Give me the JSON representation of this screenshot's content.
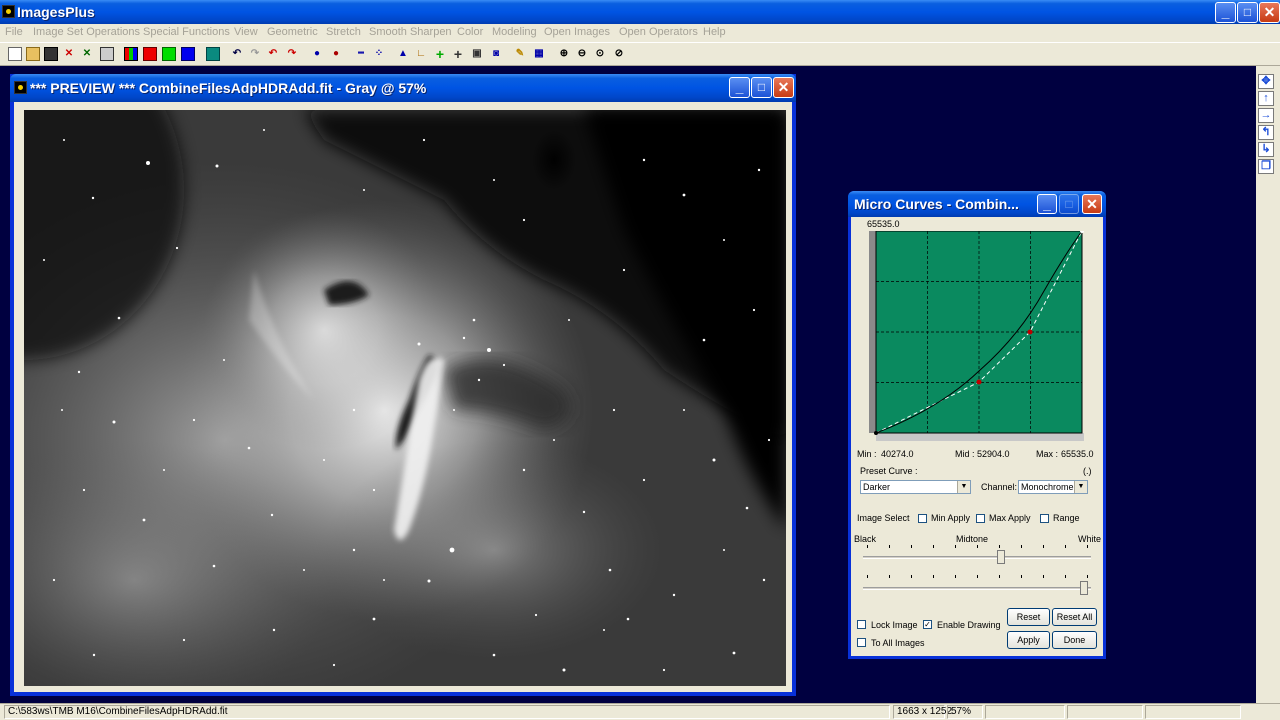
{
  "app": {
    "title": "ImagesPlus",
    "minimize_glyph": "_",
    "maximize_glyph": "□",
    "close_glyph": "✕"
  },
  "menu": {
    "items": [
      {
        "label": "File"
      },
      {
        "label": "Image Set Operations"
      },
      {
        "label": "Special Functions"
      },
      {
        "label": "View"
      },
      {
        "label": "Geometric"
      },
      {
        "label": "Stretch"
      },
      {
        "label": "Smooth Sharpen"
      },
      {
        "label": "Color"
      },
      {
        "label": "Modeling"
      },
      {
        "label": "Open Images"
      },
      {
        "label": "Open Operators"
      },
      {
        "label": "Help"
      }
    ]
  },
  "toolbar": {
    "icons": [
      {
        "name": "new-file-icon",
        "glyph": ""
      },
      {
        "name": "open-folder-icon",
        "glyph": ""
      },
      {
        "name": "save-disk-icon",
        "glyph": ""
      },
      {
        "name": "close-x-icon",
        "glyph": "✕"
      },
      {
        "name": "close-all-icon",
        "glyph": "✕"
      },
      {
        "name": "print-icon",
        "glyph": ""
      },
      {
        "name": "rgb-channels-icon",
        "glyph": ""
      },
      {
        "name": "red-channel-icon",
        "glyph": ""
      },
      {
        "name": "green-channel-icon",
        "glyph": ""
      },
      {
        "name": "blue-channel-icon",
        "glyph": ""
      },
      {
        "name": "grid-icon",
        "glyph": ""
      },
      {
        "name": "undo-icon",
        "glyph": "↶"
      },
      {
        "name": "redo-icon",
        "glyph": "↷"
      },
      {
        "name": "undo-all-icon",
        "glyph": "↶"
      },
      {
        "name": "redo-all-icon",
        "glyph": "↷"
      },
      {
        "name": "circle-select-icon",
        "glyph": "●"
      },
      {
        "name": "point-select-icon",
        "glyph": "●"
      },
      {
        "name": "line-profile-icon",
        "glyph": "┅"
      },
      {
        "name": "dots-icon",
        "glyph": "⁘"
      },
      {
        "name": "histogram-icon",
        "glyph": "▲"
      },
      {
        "name": "axis-icon",
        "glyph": "∟"
      },
      {
        "name": "crosshair-green-icon",
        "glyph": "+"
      },
      {
        "name": "crosshair-icon",
        "glyph": "+"
      },
      {
        "name": "frame-icon",
        "glyph": "▣"
      },
      {
        "name": "picture-icon",
        "glyph": "◙"
      },
      {
        "name": "pencil-icon",
        "glyph": "✎"
      },
      {
        "name": "table-icon",
        "glyph": "▦"
      },
      {
        "name": "zoom-in-icon",
        "glyph": "⊕"
      },
      {
        "name": "zoom-out-icon",
        "glyph": "⊖"
      },
      {
        "name": "zoom-fit-icon",
        "glyph": "⊙"
      },
      {
        "name": "zoom-actual-icon",
        "glyph": "⊘"
      }
    ]
  },
  "side_tools": [
    {
      "name": "move-all-icon",
      "glyph": "✥"
    },
    {
      "name": "arrow-up-icon",
      "glyph": "↑"
    },
    {
      "name": "arrow-right-icon",
      "glyph": "→"
    },
    {
      "name": "rotate-left-icon",
      "glyph": "↰"
    },
    {
      "name": "rotate-right-icon",
      "glyph": "↳"
    },
    {
      "name": "copy-icon",
      "glyph": "❐"
    }
  ],
  "preview_window": {
    "title": "*** PREVIEW *** CombineFilesAdpHDRAdd.fit - Gray @ 57%"
  },
  "curves_dialog": {
    "title": "Micro Curves - Combin...",
    "top_value": "65535.0",
    "min_label": "Min :",
    "min_value": "40274.0",
    "mid_label": "Mid :",
    "mid_value": "52904.0",
    "max_label": "Max :",
    "max_value": "65535.0",
    "preset_label": "Preset Curve :",
    "preset_extra": "(.)",
    "preset_value": "Darker",
    "channel_label": "Channel:",
    "channel_value": "Monochrome",
    "image_select_label": "Image Select",
    "min_apply_label": "Min Apply",
    "max_apply_label": "Max Apply",
    "range_label": "Range",
    "black_label": "Black",
    "midtone_label": "Midtone",
    "white_label": "White",
    "reset_label": "Reset",
    "reset_all_label": "Reset All",
    "apply_label": "Apply",
    "done_label": "Done",
    "lock_image_label": "Lock Image",
    "enable_drawing_label": "Enable Drawing",
    "to_all_images_label": "To All Images",
    "checked_glyph": "✓",
    "dropdown_glyph": "▼",
    "curve_bg_color": "#0a8a5f",
    "midtone_slider_fraction": 0.61,
    "white_slider_fraction": 0.985
  },
  "status": {
    "path": "C:\\583ws\\TMB M16\\CombineFilesAdpHDRAdd.fit",
    "dimensions": "1663 x 1252",
    "zoom": "57%"
  }
}
